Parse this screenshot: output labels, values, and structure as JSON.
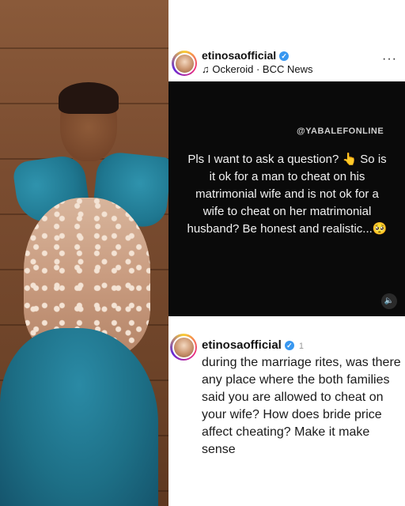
{
  "post": {
    "username": "etinosaofficial",
    "audio": "♫ Ockeroid · BCC News",
    "more": "···"
  },
  "video": {
    "watermark": "@YABALEFONLINE",
    "question": "Pls I want to ask a question? 👆 So is it ok for a man to cheat on his matrimonial wife and is not ok for a wife to cheat on her matrimonial husband? Be honest and realistic...🥺",
    "mute": "🔈"
  },
  "comment": {
    "username": "etinosaofficial",
    "extra": "1",
    "text": "during the marriage rites, was there any place where the both families said you are allowed to cheat on your wife? How does bride price affect cheating? Make it make sense"
  },
  "icons": {
    "verified": "✓",
    "verified_color": "#3897f0"
  }
}
